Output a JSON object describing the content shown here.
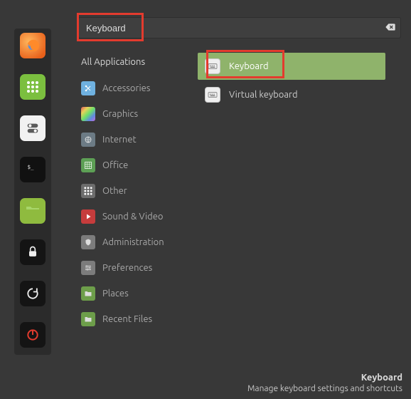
{
  "search": {
    "value": "Keyboard"
  },
  "categories_header": "All Applications",
  "categories": [
    {
      "label": "Accessories",
      "icon": "scissors-icon"
    },
    {
      "label": "Graphics",
      "icon": "palette-icon"
    },
    {
      "label": "Internet",
      "icon": "globe-icon"
    },
    {
      "label": "Office",
      "icon": "grid-icon"
    },
    {
      "label": "Other",
      "icon": "dots-icon"
    },
    {
      "label": "Sound & Video",
      "icon": "play-icon"
    },
    {
      "label": "Administration",
      "icon": "shield-icon"
    },
    {
      "label": "Preferences",
      "icon": "sliders-icon"
    },
    {
      "label": "Places",
      "icon": "folder-icon"
    },
    {
      "label": "Recent Files",
      "icon": "folder-icon"
    }
  ],
  "results": [
    {
      "label": "Keyboard",
      "selected": true
    },
    {
      "label": "Virtual keyboard",
      "selected": false
    }
  ],
  "launcher": [
    {
      "name": "firefox",
      "icon": "firefox-icon"
    },
    {
      "name": "apps",
      "icon": "apps-icon"
    },
    {
      "name": "toggle",
      "icon": "toggle-icon"
    },
    {
      "name": "terminal",
      "icon": "terminal-icon"
    },
    {
      "name": "files",
      "icon": "folder-icon"
    },
    {
      "name": "lock",
      "icon": "lock-icon"
    },
    {
      "name": "logout",
      "icon": "cycle-icon"
    },
    {
      "name": "power",
      "icon": "power-icon"
    }
  ],
  "footer": {
    "title": "Keyboard",
    "desc": "Manage keyboard settings and shortcuts"
  },
  "highlight_color": "#e33b2e",
  "accent_color": "#8fb36b"
}
